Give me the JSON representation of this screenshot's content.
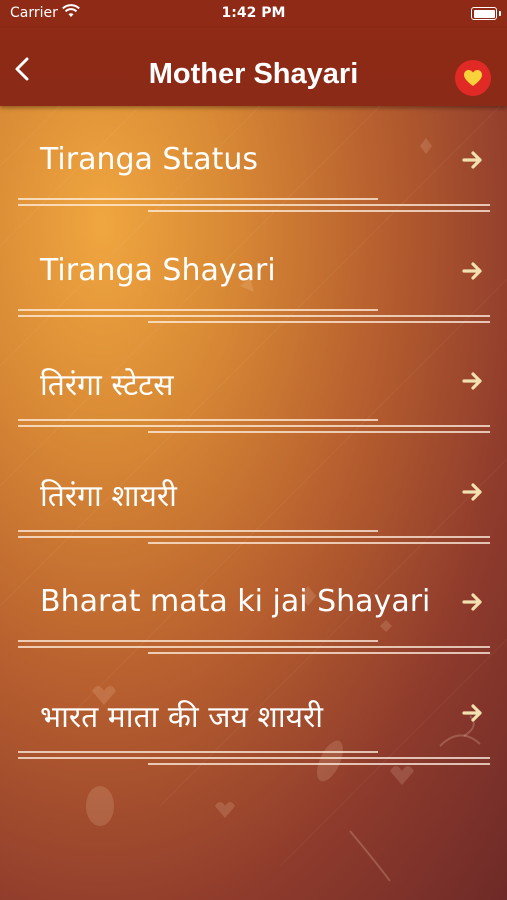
{
  "status_bar": {
    "carrier": "Carrier",
    "time": "1:42 PM"
  },
  "nav": {
    "title": "Mother Shayari",
    "back_icon": "chevron-left",
    "favorite_icon": "heart"
  },
  "colors": {
    "nav_bar": "#8e2a16",
    "favorite_button": "#e12a26",
    "heart": "#f7d23a",
    "arrow": "#f3e0b0"
  },
  "menu": {
    "items": [
      {
        "label": "Tiranga Status"
      },
      {
        "label": "Tiranga Shayari"
      },
      {
        "label": "तिरंगा स्टेटस"
      },
      {
        "label": "तिरंगा शायरी"
      },
      {
        "label": "Bharat mata ki jai Shayari"
      },
      {
        "label": "भारत माता की जय शायरी"
      }
    ]
  }
}
